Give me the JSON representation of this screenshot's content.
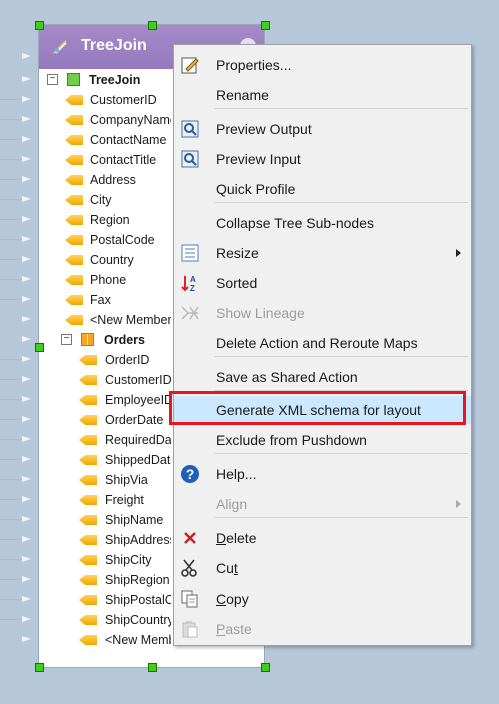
{
  "node": {
    "title": "TreeJoin",
    "groups": [
      {
        "label": "TreeJoin",
        "icon": "green-square-icon",
        "fields": [
          "CustomerID",
          "CompanyName",
          "ContactName",
          "ContactTitle",
          "Address",
          "City",
          "Region",
          "PostalCode",
          "Country",
          "Phone",
          "Fax",
          "<New Member>"
        ]
      },
      {
        "label": "Orders",
        "icon": "orange-grid-icon",
        "fields": [
          "OrderID",
          "CustomerID",
          "EmployeeID",
          "OrderDate",
          "RequiredDate",
          "ShippedDate",
          "ShipVia",
          "Freight",
          "ShipName",
          "ShipAddress",
          "ShipCity",
          "ShipRegion",
          "ShipPostalCode",
          "ShipCountry",
          "<New Member>"
        ]
      }
    ]
  },
  "menu": [
    {
      "label": "Properties...",
      "icon": "properties-icon",
      "enabled": true
    },
    {
      "label": "Rename",
      "icon": "",
      "enabled": true
    },
    {
      "sep": true
    },
    {
      "label": "Preview Output",
      "icon": "preview-output-icon",
      "enabled": true
    },
    {
      "label": "Preview Input",
      "icon": "preview-input-icon",
      "enabled": true
    },
    {
      "label": "Quick Profile",
      "icon": "",
      "enabled": true
    },
    {
      "sep": true
    },
    {
      "label": "Collapse Tree Sub-nodes",
      "icon": "",
      "enabled": true
    },
    {
      "label": "Resize",
      "icon": "resize-icon",
      "enabled": true,
      "submenu": true
    },
    {
      "label": "Sorted",
      "icon": "sort-icon",
      "enabled": true
    },
    {
      "label": "Show Lineage",
      "icon": "lineage-icon",
      "enabled": false
    },
    {
      "label": "Delete Action and Reroute Maps",
      "icon": "",
      "enabled": true
    },
    {
      "sep": true
    },
    {
      "label": "Save as Shared Action",
      "icon": "",
      "enabled": true
    },
    {
      "sep": true
    },
    {
      "label": "Generate XML schema for layout",
      "icon": "",
      "enabled": true,
      "highlighted": true
    },
    {
      "label": "Exclude from Pushdown",
      "icon": "",
      "enabled": true
    },
    {
      "sep": true
    },
    {
      "label": "Help...",
      "icon": "help-icon",
      "enabled": true
    },
    {
      "label": "Align",
      "icon": "",
      "enabled": false,
      "submenu": true
    },
    {
      "sep": true
    },
    {
      "label": "Delete",
      "icon": "delete-icon",
      "enabled": true,
      "underline": "D"
    },
    {
      "label": "Cut",
      "icon": "cut-icon",
      "enabled": true,
      "underline": "t"
    },
    {
      "label": "Copy",
      "icon": "copy-icon",
      "enabled": true,
      "underline": "C"
    },
    {
      "label": "Paste",
      "icon": "paste-icon",
      "enabled": false,
      "underline": "P"
    }
  ],
  "colors": {
    "header": "#9a7ec2",
    "highlight": "#cce8ff",
    "callout": "#e8141e",
    "handle": "#3fcf1b"
  }
}
